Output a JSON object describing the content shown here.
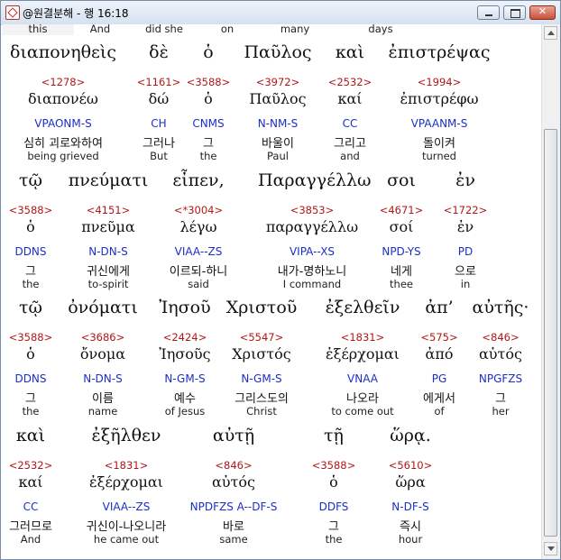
{
  "window": {
    "title": "@원결분해 - 행 16:18"
  },
  "top_partial": [
    "this",
    "And",
    "did she",
    "on",
    "many",
    "days"
  ],
  "rows": [
    [
      {
        "g": "διαπονηθεὶς",
        "n": "<1278>",
        "l": "διαπονέω",
        "p": "VPAONM-S",
        "k": "심히 괴로와하여",
        "e": "being grieved"
      },
      {
        "g": "δὲ",
        "n": "<1161>",
        "l": "δώ",
        "p": "CH",
        "k": "그러나",
        "e": "But"
      },
      {
        "g": "ὁ",
        "n": "<3588>",
        "l": "ὁ",
        "p": "CNMS",
        "k": "그",
        "e": "the"
      },
      {
        "g": "Παῦλος",
        "n": "<3972>",
        "l": "Παῦλος",
        "p": "N-NM-S",
        "k": "바울이",
        "e": "Paul"
      },
      {
        "g": "καὶ",
        "n": "<2532>",
        "l": "καί",
        "p": "CC",
        "k": "그리고",
        "e": "and"
      },
      {
        "g": "ἐπιστρέψας",
        "n": "<1994>",
        "l": "ἐπιστρέφω",
        "p": "VPAANM-S",
        "k": "돌이켜",
        "e": "turned"
      }
    ],
    [
      {
        "g": "τῷ",
        "n": "<3588>",
        "l": "ὁ",
        "p": "DDNS",
        "k": "그",
        "e": "the"
      },
      {
        "g": "πνεύματι",
        "n": "<4151>",
        "l": "πνεῦμα",
        "p": "N-DN-S",
        "k": "귀신에게",
        "e": "to-spirit"
      },
      {
        "g": "εἶπεν,",
        "n": "<*3004>",
        "l": "λέγω",
        "p": "VIAA--ZS",
        "k": "이르되-하니",
        "e": "said"
      },
      {
        "g": "Παραγγέλλω",
        "n": "<3853>",
        "l": "παραγγέλλω",
        "p": "VIPA--XS",
        "k": "내가-명하노니",
        "e": "I command"
      },
      {
        "g": "σοι",
        "n": "<4671>",
        "l": "σοί",
        "p": "NPD-YS",
        "k": "네게",
        "e": "thee"
      },
      {
        "g": "ἐν",
        "n": "<1722>",
        "l": "ἐν",
        "p": "PD",
        "k": "으로",
        "e": "in"
      }
    ],
    [
      {
        "g": "τῷ",
        "n": "<3588>",
        "l": "ὁ",
        "p": "DDNS",
        "k": "그",
        "e": "the"
      },
      {
        "g": "ὀνόματι",
        "n": "<3686>",
        "l": "ὄνομα",
        "p": "N-DN-S",
        "k": "이름",
        "e": "name"
      },
      {
        "g": "Ἰησοῦ",
        "n": "<2424>",
        "l": "Ἰησοῦς",
        "p": "N-GM-S",
        "k": "예수",
        "e": "of Jesus"
      },
      {
        "g": "Χριστοῦ",
        "n": "<5547>",
        "l": "Χριστός",
        "p": "N-GM-S",
        "k": "그리스도의",
        "e": "Christ"
      },
      {
        "g": "ἐξελθεῖν",
        "n": "<1831>",
        "l": "ἐξέρχομαι",
        "p": "VNAA",
        "k": "나오라",
        "e": "to come out"
      },
      {
        "g": "ἀπ’",
        "n": "<575>",
        "l": "ἀπό",
        "p": "PG",
        "k": "에게서",
        "e": "of"
      },
      {
        "g": "αὐτῆς·",
        "n": "<846>",
        "l": "αὐτός",
        "p": "NPGFZS",
        "k": "그",
        "e": "her"
      }
    ],
    [
      {
        "g": "καὶ",
        "n": "<2532>",
        "l": "καί",
        "p": "CC",
        "k": "그러므로",
        "e": "And"
      },
      {
        "g": "ἐξῆλθεν",
        "n": "<1831>",
        "l": "ἐξέρχομαι",
        "p": "VIAA--ZS",
        "k": "귀신이-나오니라",
        "e": "he came out"
      },
      {
        "g": "αὐτῇ",
        "n": "<846>",
        "l": "αὐτός",
        "p": "NPDFZS A--DF-S",
        "k": "바로",
        "e": "same"
      },
      {
        "g": "τῇ",
        "n": "<3588>",
        "l": "ὁ",
        "p": "DDFS",
        "k": "그",
        "e": "the"
      },
      {
        "g": "ὥρᾳ.",
        "n": "<5610>",
        "l": "ὥρα",
        "p": "N-DF-S",
        "k": "즉시",
        "e": "hour"
      }
    ]
  ]
}
